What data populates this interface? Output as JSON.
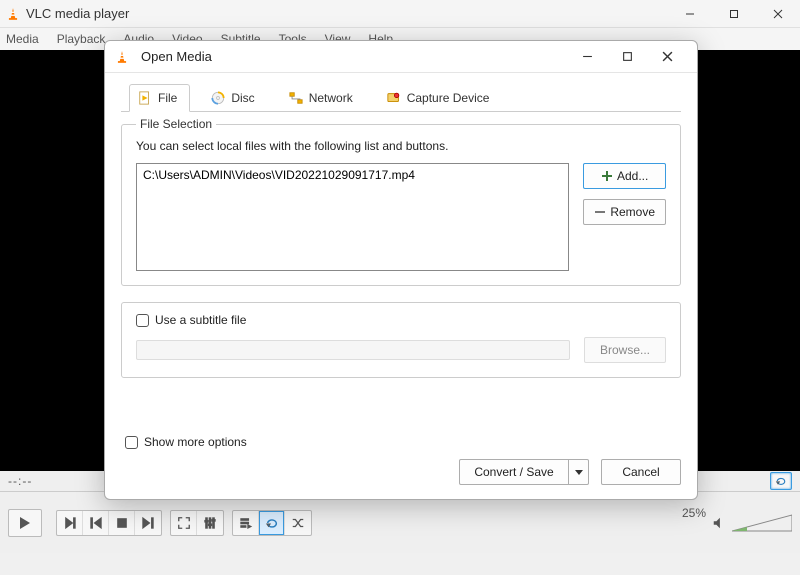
{
  "main_window": {
    "title": "VLC media player",
    "menu": [
      "Media",
      "Playback",
      "Audio",
      "Video",
      "Subtitle",
      "Tools",
      "View",
      "Help"
    ],
    "time_left": "--:--",
    "time_right": "--:--",
    "volume_pct": "25%"
  },
  "dialog": {
    "title": "Open Media",
    "tabs": {
      "file": "File",
      "disc": "Disc",
      "network": "Network",
      "capture": "Capture Device"
    },
    "file_section": {
      "legend": "File Selection",
      "help": "You can select local files with the following list and buttons.",
      "files": [
        "C:\\Users\\ADMIN\\Videos\\VID20221029091717.mp4"
      ],
      "add_label": "Add...",
      "remove_label": "Remove"
    },
    "subtitle": {
      "checkbox_label": "Use a subtitle file",
      "browse_label": "Browse..."
    },
    "show_more_label": "Show more options",
    "footer": {
      "convert_label": "Convert / Save",
      "cancel_label": "Cancel"
    }
  }
}
